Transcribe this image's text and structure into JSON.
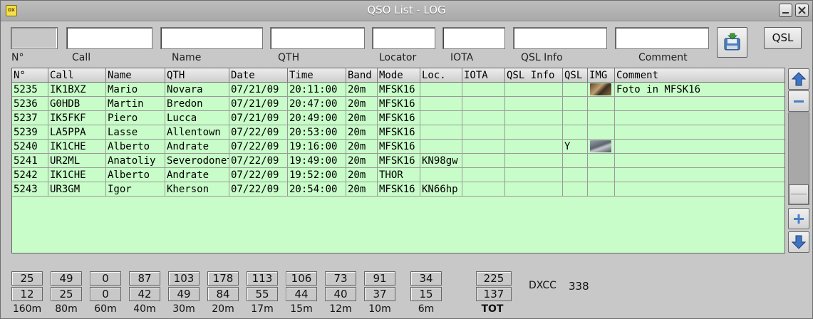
{
  "window": {
    "app_icon_text": "DX",
    "title": "QSO List - LOG"
  },
  "filters": {
    "number": {
      "label": "N°",
      "value": ""
    },
    "call": {
      "label": "Call",
      "value": ""
    },
    "name": {
      "label": "Name",
      "value": ""
    },
    "qth": {
      "label": "QTH",
      "value": ""
    },
    "locator": {
      "label": "Locator",
      "value": ""
    },
    "iota": {
      "label": "IOTA",
      "value": ""
    },
    "qsl_info": {
      "label": "QSL Info",
      "value": ""
    },
    "comment": {
      "label": "Comment",
      "value": ""
    },
    "qsl_button": "QSL",
    "save_icon": "disk-save-icon"
  },
  "table": {
    "headers": [
      "N°",
      "Call",
      "Name",
      "QTH",
      "Date",
      "Time",
      "Band",
      "Mode",
      "Loc.",
      "IOTA",
      "QSL Info",
      "QSL",
      "IMG",
      "Comment"
    ],
    "rows": [
      [
        "5235",
        "IK1BXZ",
        "Mario",
        "Novara",
        "07/21/09",
        "20:11:00",
        "20m",
        "MFSK16",
        "",
        "",
        "",
        "",
        "img",
        "Foto in MFSK16"
      ],
      [
        "5236",
        "G0HDB",
        "Martin",
        "Bredon",
        "07/21/09",
        "20:47:00",
        "20m",
        "MFSK16",
        "",
        "",
        "",
        "",
        "",
        ""
      ],
      [
        "5237",
        "IK5FKF",
        "Piero",
        "Lucca",
        "07/21/09",
        "20:49:00",
        "20m",
        "MFSK16",
        "",
        "",
        "",
        "",
        "",
        ""
      ],
      [
        "5239",
        "LA5PPA",
        "Lasse",
        "Allentown",
        "07/22/09",
        "20:53:00",
        "20m",
        "MFSK16",
        "",
        "",
        "",
        "",
        "",
        ""
      ],
      [
        "5240",
        "IK1CHE",
        "Alberto",
        "Andrate",
        "07/22/09",
        "19:16:00",
        "20m",
        "MFSK16",
        "",
        "",
        "",
        "Y",
        "img",
        ""
      ],
      [
        "5241",
        "UR2ML",
        "Anatoliy",
        "Severodonetsk",
        "07/22/09",
        "19:49:00",
        "20m",
        "MFSK16",
        "KN98gw",
        "",
        "",
        "",
        "",
        ""
      ],
      [
        "5242",
        "IK1CHE",
        "Alberto",
        "Andrate",
        "07/22/09",
        "19:52:00",
        "20m",
        "THOR",
        "",
        "",
        "",
        "",
        "",
        ""
      ],
      [
        "5243",
        "UR3GM",
        "Igor",
        "Kherson",
        "07/22/09",
        "20:54:00",
        "20m",
        "MFSK16",
        "KN66hp",
        "",
        "",
        "",
        "",
        ""
      ]
    ],
    "colors": {
      "row_bg": "#c8fcc8",
      "header_bg": "#dcdcdc"
    }
  },
  "scroll_controls": {
    "first_icon": "arrow-up-icon",
    "remove_icon": "minus-icon",
    "add_icon": "plus-icon",
    "last_icon": "arrow-down-icon"
  },
  "bands": [
    {
      "label": "160m",
      "top": "25",
      "bottom": "12"
    },
    {
      "label": "80m",
      "top": "49",
      "bottom": "25"
    },
    {
      "label": "60m",
      "top": "0",
      "bottom": "0"
    },
    {
      "label": "40m",
      "top": "87",
      "bottom": "42"
    },
    {
      "label": "30m",
      "top": "103",
      "bottom": "49"
    },
    {
      "label": "20m",
      "top": "178",
      "bottom": "84"
    },
    {
      "label": "17m",
      "top": "113",
      "bottom": "55"
    },
    {
      "label": "15m",
      "top": "106",
      "bottom": "44"
    },
    {
      "label": "12m",
      "top": "73",
      "bottom": "40"
    },
    {
      "label": "10m",
      "top": "91",
      "bottom": "37"
    },
    {
      "label": "6m",
      "top": "34",
      "bottom": "15"
    }
  ],
  "total": {
    "label": "TOT",
    "top": "225",
    "bottom": "137"
  },
  "dxcc": {
    "label": "DXCC",
    "value": "338"
  }
}
